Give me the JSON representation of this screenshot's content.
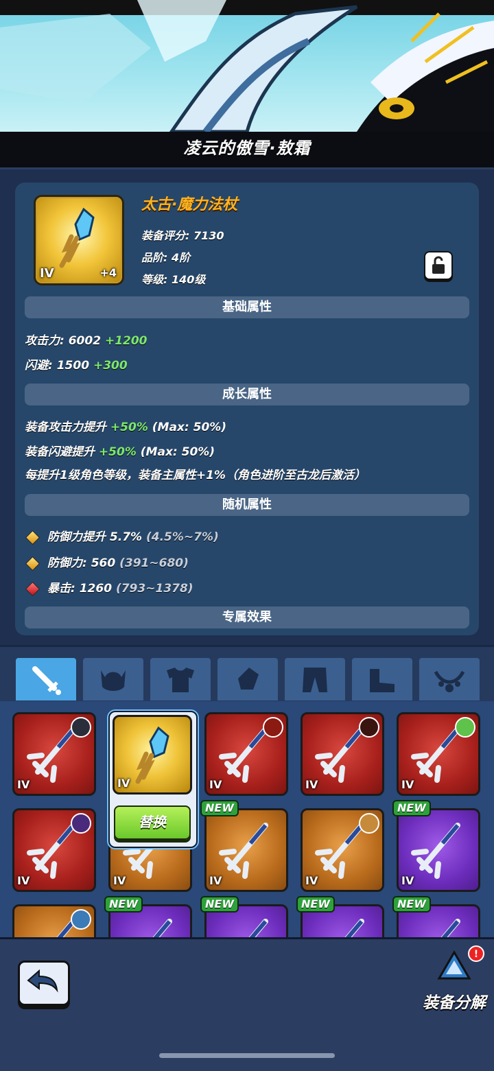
{
  "hero": {
    "name": "凌云的傲雪·敖霜"
  },
  "item": {
    "name": "太古·魔力法杖",
    "tier": "IV",
    "enhance": "+4",
    "score_label": "装备评分: 7130",
    "grade_label": "品阶: 4阶",
    "level_label": "等级: 140级"
  },
  "sections": {
    "basic": "基础属性",
    "growth": "成长属性",
    "random": "随机属性",
    "exclusive": "专属效果"
  },
  "basic_attrs": [
    {
      "label": "攻击力: 6002",
      "bonus": "+1200"
    },
    {
      "label": "闪避: 1500",
      "bonus": "+300"
    }
  ],
  "growth_attrs": [
    {
      "label": "装备攻击力提升",
      "bonus": "+50%",
      "max": "(Max: 50%)"
    },
    {
      "label": "装备闪避提升",
      "bonus": "+50%",
      "max": "(Max: 50%)"
    },
    {
      "label": "每提升1级角色等级，装备主属性+1%（角色进阶至古龙后激活）",
      "bonus": "",
      "max": ""
    }
  ],
  "random_attrs": [
    {
      "label": "防御力提升 5.7%",
      "range": "(4.5%~7%)",
      "gem": "gold"
    },
    {
      "label": "防御力: 560",
      "range": "(391~680)",
      "gem": "gold"
    },
    {
      "label": "暴击: 1260",
      "range": "(793~1378)",
      "gem": "red"
    }
  ],
  "tabs": [
    "sword-icon",
    "helmet-icon",
    "armor-icon",
    "bracer-icon",
    "pants-icon",
    "boots-icon",
    "necklace-icon"
  ],
  "grid": {
    "new_label": "NEW",
    "tier_label": "IV",
    "replace_label": "替换",
    "rows": [
      [
        {
          "color": "red",
          "badge": "#2a2e3a"
        },
        {
          "color": "gold",
          "selected": true
        },
        {
          "color": "red",
          "badge": "#8a1a12"
        },
        {
          "color": "red",
          "badge": "#3a1510"
        },
        {
          "color": "red",
          "badge": "#5fc24a"
        }
      ],
      [
        {
          "color": "red",
          "badge": "#4a2a7a"
        },
        {
          "color": "orange"
        },
        {
          "color": "orange",
          "isNew": true
        },
        {
          "color": "orange",
          "badge": "#c58b3a"
        },
        {
          "color": "purple",
          "isNew": true
        }
      ],
      [
        {
          "color": "orange",
          "badge": "#3b7bb8"
        },
        {
          "color": "purple",
          "isNew": true
        },
        {
          "color": "purple",
          "isNew": true
        },
        {
          "color": "purple",
          "isNew": true
        },
        {
          "color": "purple",
          "isNew": true
        }
      ]
    ]
  },
  "bottom": {
    "dismantle_label": "装备分解",
    "notify": "!"
  },
  "colors": {
    "gold_text": "#ffb21e",
    "green_bonus": "#7ee86a",
    "panel": "#26476a"
  }
}
